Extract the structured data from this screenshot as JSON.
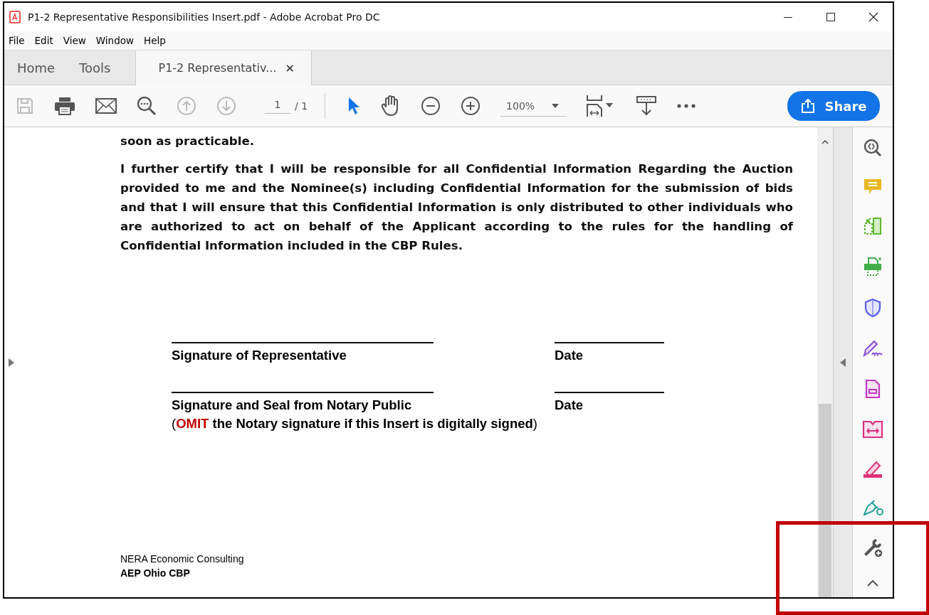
{
  "window": {
    "title": "P1-2 Representative Responsibilities Insert.pdf - Adobe Acrobat Pro DC"
  },
  "menu": [
    "File",
    "Edit",
    "View",
    "Window",
    "Help"
  ],
  "tabs": [
    {
      "label": "Home",
      "selected": false
    },
    {
      "label": "Tools",
      "selected": false
    },
    {
      "label": "P1-2 Representativ...",
      "selected": true,
      "close": "×"
    }
  ],
  "toolbar": {
    "page": "1",
    "page_total": "/ 1",
    "zoom": "100%",
    "share": "Share"
  },
  "document": {
    "paragraphs": [
      "soon as practicable.",
      "I further certify that I will be responsible for all Confidential Information Regarding the Auction provided to me and the Nominee(s) including Confidential Information for the submission of bids and that I will ensure that this Confidential Information is only distributed to other individuals who are authorized to act on behalf of the Applicant according to the rules for the handling of Confidential Information included in the CBP Rules."
    ],
    "signatures": [
      {
        "label": "Signature of Representative",
        "date_label": "Date"
      },
      {
        "label": "Signature and Seal from Notary Public",
        "date_label": "Date"
      }
    ],
    "note": "(**OMIT** **the Notary signature if this Insert is digitally signed**)",
    "footer": [
      "NERA Economic Consulting",
      "AEP Ohio CBP"
    ]
  },
  "annotations": [
    {
      "kind": "rectangle",
      "color": "#c00000"
    }
  ]
}
